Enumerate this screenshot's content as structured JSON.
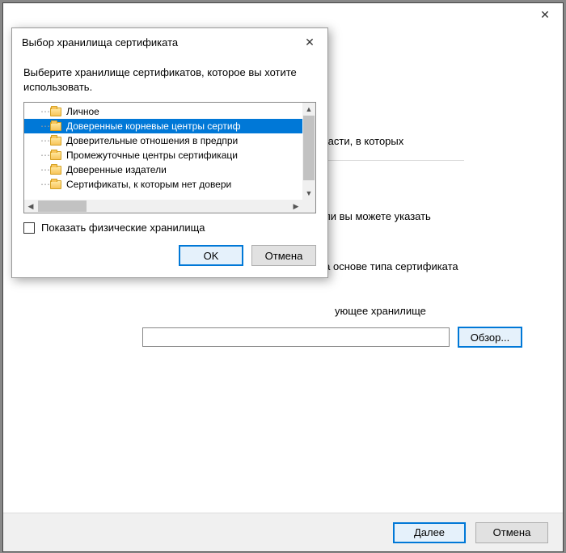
{
  "mainWindow": {
    "close": "✕",
    "lines": {
      "l1": "области, в которых",
      "l2": "ше, или вы можете указать",
      "l3": "на основе типа сертификата",
      "l4": "ующее хранилище"
    },
    "browseLabel": "Обзор...",
    "footer": {
      "next": "Далее",
      "cancel": "Отмена"
    }
  },
  "modal": {
    "title": "Выбор хранилища сертификата",
    "close": "✕",
    "instruction": "Выберите хранилище сертификатов, которое вы хотите использовать.",
    "tree": [
      {
        "label": "Личное",
        "selected": false
      },
      {
        "label": "Доверенные корневые центры сертиф",
        "selected": true
      },
      {
        "label": "Доверительные отношения в предпри",
        "selected": false
      },
      {
        "label": "Промежуточные центры сертификаци",
        "selected": false
      },
      {
        "label": "Доверенные издатели",
        "selected": false
      },
      {
        "label": "Сертификаты, к которым нет довери",
        "selected": false
      }
    ],
    "showPhysical": "Показать физические хранилища",
    "ok": "OK",
    "cancel": "Отмена"
  }
}
